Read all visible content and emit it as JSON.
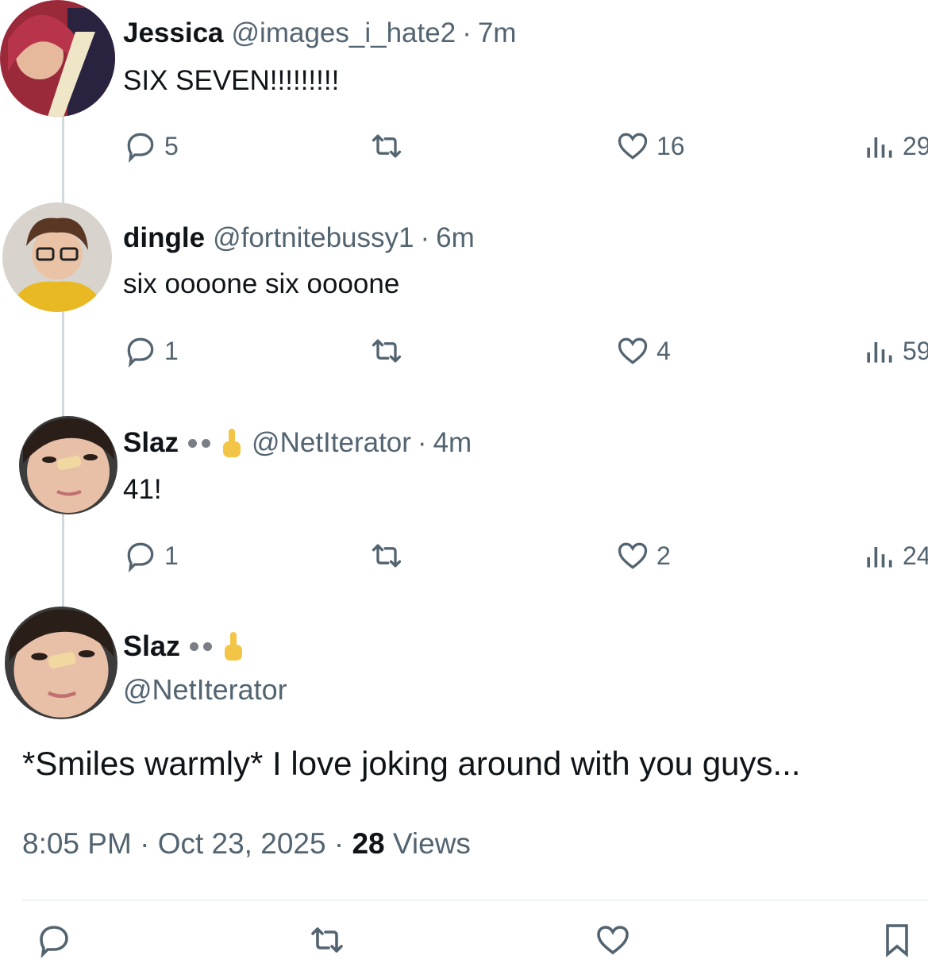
{
  "tweets": [
    {
      "name": "Jessica",
      "handle": "@images_i_hate2",
      "dot": "·",
      "time": "7m",
      "text": "SIX SEVEN!!!!!!!!!",
      "replies": "5",
      "likes": "16",
      "views": "29"
    },
    {
      "name": "dingle",
      "handle": "@fortnitebussy1",
      "dot": "·",
      "time": "6m",
      "text": "six oooone six oooone",
      "replies": "1",
      "likes": "4",
      "views": "59"
    },
    {
      "name": "Slaz",
      "handle": "@NetIterator",
      "dot": "·",
      "time": "4m",
      "text": "41!",
      "replies": "1",
      "likes": "2",
      "views": "24"
    }
  ],
  "main": {
    "name": "Slaz",
    "handle": "@NetIterator",
    "text": "*Smiles warmly* I love joking around with you guys...",
    "time": "8:05 PM",
    "dot": "·",
    "date": "Oct 23, 2025",
    "views_count": "28",
    "views_label": "Views"
  },
  "icons": {
    "reply": "reply-icon",
    "retweet": "retweet-icon",
    "like": "heart-icon",
    "views": "views-chart-icon",
    "bookmark": "bookmark-icon"
  },
  "colors": {
    "text": "#0f1419",
    "secondary": "#536471",
    "thread_line": "#cfd9de"
  }
}
